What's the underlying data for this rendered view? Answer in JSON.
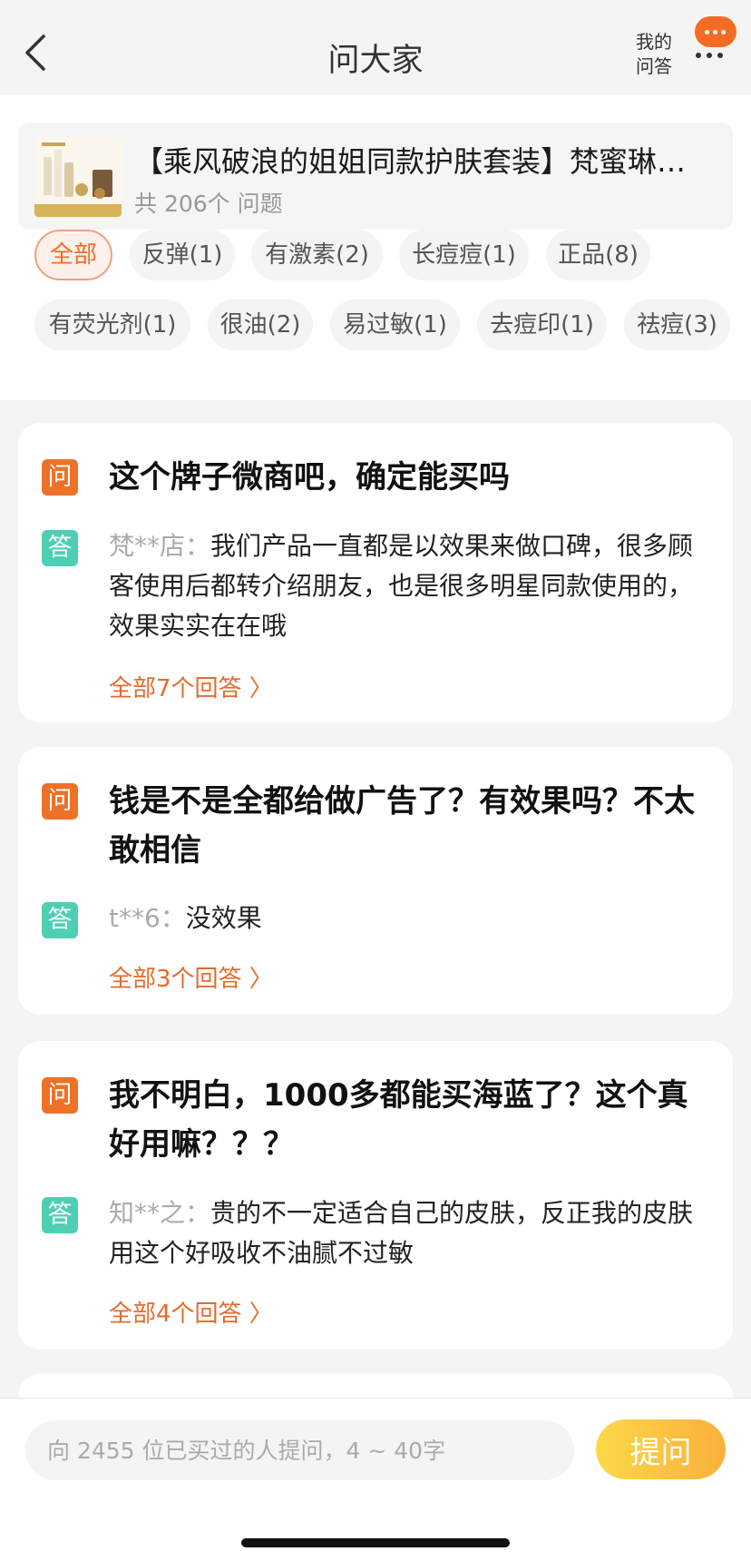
{
  "header": {
    "title": "问大家",
    "my_qa_line1": "我的",
    "my_qa_line2": "问答"
  },
  "product": {
    "title": "【乘风破浪的姐姐同款护肤套装】梵蜜琳贵妇膏套装",
    "count_text": "共 206个 问题"
  },
  "tags": [
    {
      "label": "全部",
      "active": true
    },
    {
      "label": "反弹(1)",
      "active": false
    },
    {
      "label": "有激素(2)",
      "active": false
    },
    {
      "label": "长痘痘(1)",
      "active": false
    },
    {
      "label": "正品(8)",
      "active": false
    },
    {
      "label": "有荧光剂(1)",
      "active": false
    },
    {
      "label": "很油(2)",
      "active": false
    },
    {
      "label": "易过敏(1)",
      "active": false
    },
    {
      "label": "去痘印(1)",
      "active": false
    },
    {
      "label": "祛痘(3)",
      "active": false
    }
  ],
  "labels": {
    "question_badge": "问",
    "answer_badge": "答"
  },
  "questions": [
    {
      "question": "这个牌子微商吧，确定能买吗",
      "answer_user": "梵**店：",
      "answer": "我们产品一直都是以效果来做口碑，很多顾客使用后都转介绍朋友，也是很多明星同款使用的，效果实实在在哦",
      "all_link": "全部7个回答 〉"
    },
    {
      "question": "钱是不是全都给做广告了？有效果吗？不太敢相信",
      "answer_user": "t**6：",
      "answer": "没效果",
      "all_link": "全部3个回答 〉"
    },
    {
      "question": "我不明白，1000多都能买海蓝了？这个真好用嘛？？？",
      "answer_user": "知**之：",
      "answer": "贵的不一定适合自己的皮肤，反正我的皮肤用这个好吸收不油腻不过敏",
      "all_link": "全部4个回答 〉"
    }
  ],
  "ask": {
    "placeholder": "向 2455 位已买过的人提问，4 ~ 40字",
    "button_label": "提问"
  },
  "colors": {
    "accent_orange": "#f36b25",
    "answer_green": "#4ecfb4",
    "link_orange": "#e46b2c",
    "ask_button": "#fbb03b"
  }
}
